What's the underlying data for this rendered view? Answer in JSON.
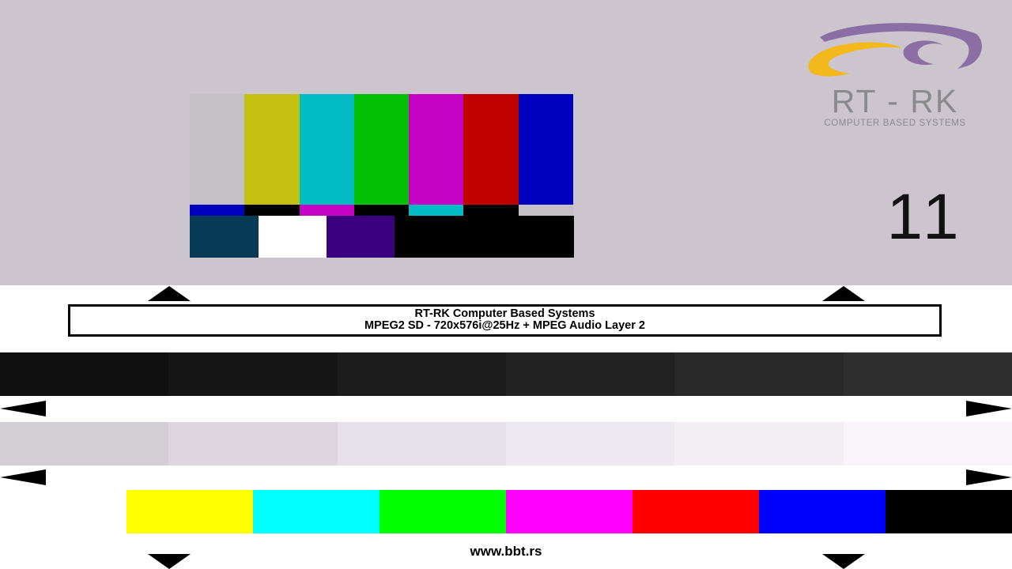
{
  "colors": {
    "background": "#cdc5ce",
    "smpte_top": [
      "#c4c0c6",
      "#c4c012",
      "#04bdc4",
      "#04c004",
      "#c404c2",
      "#c10000",
      "#0000c1"
    ],
    "smpte_mid": [
      "#0000c1",
      "#000000",
      "#c404c2",
      "#000000",
      "#04bdc4",
      "#000000",
      "#c4c0c6"
    ],
    "smpte_bottom": [
      "#063a55",
      "#ffffff",
      "#3a0080",
      "#000000",
      "#000000",
      "#000000"
    ],
    "gray_dark": [
      "#101010",
      "#161616",
      "#1c1c1c",
      "#222222",
      "#282828",
      "#2e2e2e"
    ],
    "gray_light": [
      "#d3cdd4",
      "#ddd6df",
      "#e6e0e8",
      "#ede7ef",
      "#f3edf4",
      "#f9f4fa"
    ],
    "bottom_bars": [
      "#ffff00",
      "#00ffff",
      "#00ff00",
      "#ff00ff",
      "#ff0000",
      "#0000ff",
      "#000000"
    ]
  },
  "logo": {
    "name": "RT - RK",
    "tagline": "COMPUTER BASED SYSTEMS"
  },
  "channel_number": "11",
  "info": {
    "line1": "RT-RK Computer Based Systems",
    "line2": "MPEG2 SD - 720x576i@25Hz + MPEG Audio Layer 2"
  },
  "url": "www.bbt.rs"
}
